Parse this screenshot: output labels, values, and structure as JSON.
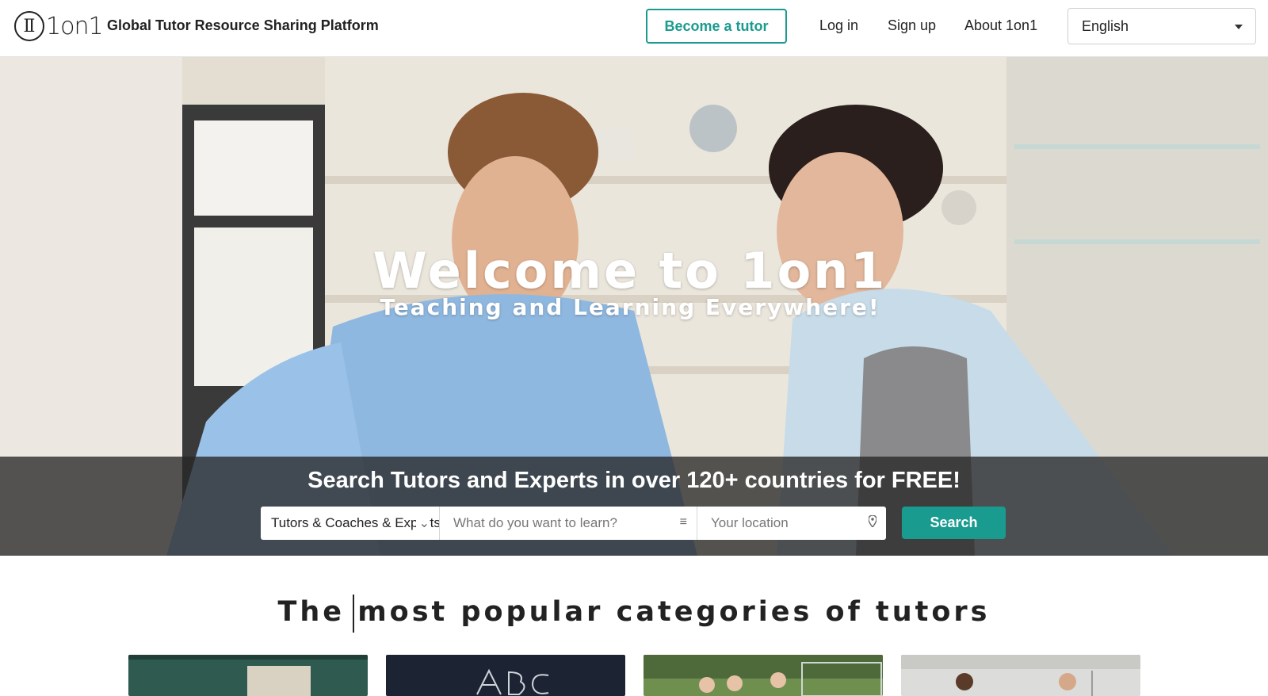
{
  "header": {
    "logo_text": "1on1",
    "tagline": "Global Tutor Resource Sharing Platform",
    "become_tutor_label": "Become a tutor",
    "login_label": "Log in",
    "signup_label": "Sign up",
    "about_label": "About 1on1",
    "language_selected": "English"
  },
  "hero": {
    "title": "Welcome to 1on1",
    "subtitle": "Teaching and Learning Everywhere!",
    "search_heading": "Search Tutors and Experts in over 120+ countries for FREE!",
    "category_value": "Tutors & Coaches & Experts",
    "what_placeholder": "What do you want to learn?",
    "location_placeholder": "Your location",
    "search_button_label": "Search"
  },
  "categories": {
    "title": "The most popular categories of tutors",
    "cards": [
      {
        "name": "category-card-1",
        "icon": "chalkboard-image"
      },
      {
        "name": "category-card-2",
        "icon": "abc-blackboard-image"
      },
      {
        "name": "category-card-3",
        "icon": "sports-kids-image"
      },
      {
        "name": "category-card-4",
        "icon": "gym-basketball-image"
      }
    ]
  },
  "colors": {
    "accent": "#1a9b8f",
    "search_band": "#282828",
    "text": "#222222"
  }
}
